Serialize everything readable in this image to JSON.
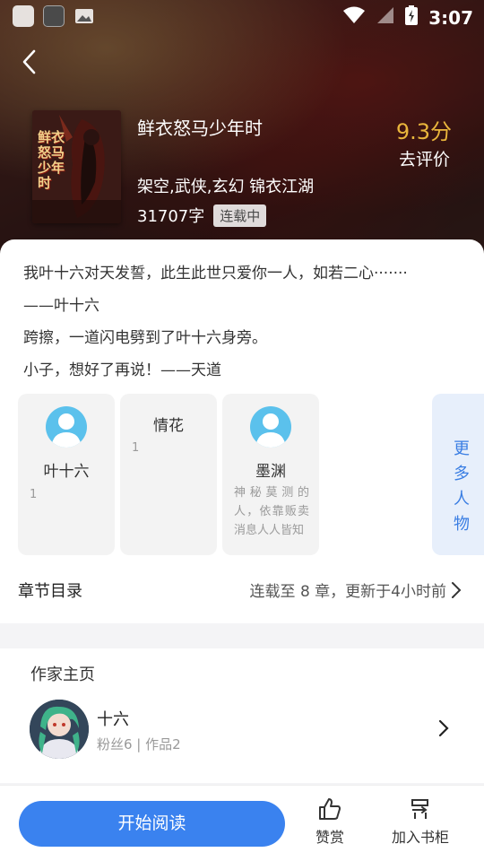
{
  "status_bar": {
    "time": "3:07"
  },
  "book": {
    "title": "鲜衣怒马少年时",
    "tags": "架空,武侠,玄幻 锦衣江湖",
    "word_count": "31707字",
    "status": "连载中",
    "rating": "9.3分",
    "rate_link": "去评价",
    "cover_text": "鲜衣怒马少年时"
  },
  "intro": [
    "我叶十六对天发誓，此生此世只爱你一人，如若二心·······",
    "——叶十六",
    "跨擦，一道闪电劈到了叶十六身旁。",
    "小子，想好了再说！——天道"
  ],
  "characters": [
    {
      "name": "叶十六",
      "count": "1",
      "desc": ""
    },
    {
      "name": "情花",
      "count": "1",
      "desc": ""
    },
    {
      "name": "墨渊",
      "count": "",
      "desc": "神秘莫测的人，依靠贩卖消息人人皆知"
    }
  ],
  "more_characters": "更多人物",
  "toc": {
    "label": "章节目录",
    "info": "连载至 8 章，更新于4小时前"
  },
  "author": {
    "heading": "作家主页",
    "name": "十六",
    "stats": "粉丝6 | 作品2"
  },
  "bottom": {
    "read": "开始阅读",
    "like": "赞赏",
    "shelf": "加入书柜"
  },
  "colors": {
    "accent": "#3a82ef",
    "rating": "#e9b53c"
  }
}
